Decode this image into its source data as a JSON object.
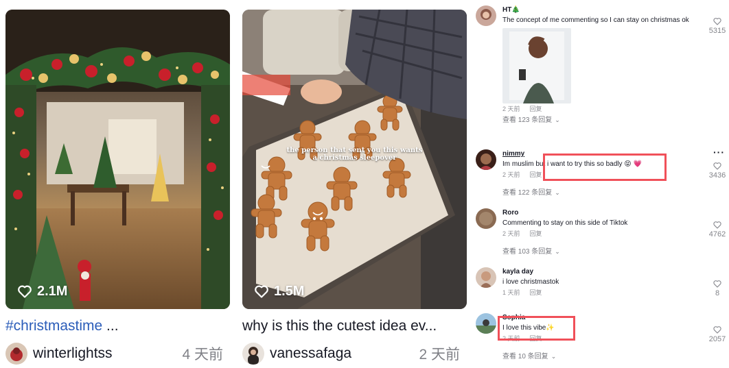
{
  "videos": [
    {
      "likes": "2.1M",
      "caption_tag": "#christmastime",
      "caption_rest": " ...",
      "author": "winterlightss",
      "time": "4 天前"
    },
    {
      "likes": "1.5M",
      "caption_tag": "",
      "caption_rest": "why is this the cutest idea ev...",
      "author": "vanessafaga",
      "time": "2 天前",
      "overlay_text_1": "the person that sent you this wants",
      "overlay_text_2": "a christmas sleepover"
    }
  ],
  "comments": [
    {
      "username": "HT🎄",
      "text": "The concept of me commenting so I can stay on christmas ok",
      "age": "2 天前",
      "reply": "回复",
      "likes": "5315",
      "view_replies": "查看 123 条回复"
    },
    {
      "username": "nimmy",
      "text": "Im muslim but i want to try this so badly 😝 💗",
      "age": "2 天前",
      "reply": "回复",
      "likes": "3436",
      "view_replies": "查看 122 条回复",
      "more": "···"
    },
    {
      "username": "Roro",
      "text": "Commenting to stay on this side of Tiktok",
      "age": "2 天前",
      "reply": "回复",
      "likes": "4762",
      "view_replies": "查看 103 条回复"
    },
    {
      "username": "kayla day",
      "text": "i love christmastok",
      "age": "1 天前",
      "reply": "回复",
      "likes": "8"
    },
    {
      "username": "Sophia",
      "text": "I love this vibe✨",
      "age": "2 天前",
      "reply": "回复",
      "likes": "2057",
      "view_replies": "查看 10 条回复"
    }
  ],
  "colors": {
    "hashtag": "#2b5db9",
    "highlight_box": "#f05059"
  }
}
